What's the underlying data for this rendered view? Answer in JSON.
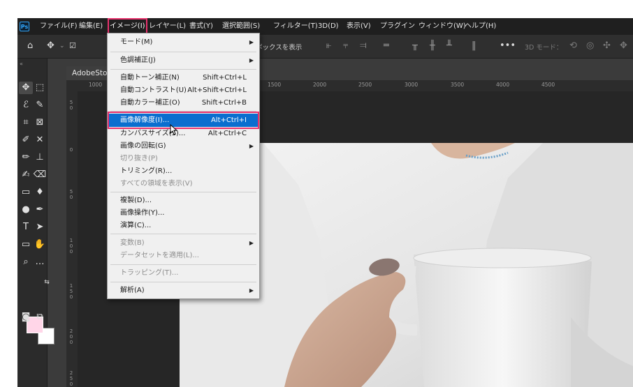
{
  "menubar": {
    "items": [
      {
        "label": "ファイル(F)"
      },
      {
        "label": "編集(E)"
      },
      {
        "label": "イメージ(I)"
      },
      {
        "label": "レイヤー(L)"
      },
      {
        "label": "書式(Y)"
      },
      {
        "label": "選択範囲(S)"
      },
      {
        "label": "フィルター(T)"
      },
      {
        "label": "3D(D)"
      },
      {
        "label": "表示(V)"
      },
      {
        "label": "プラグイン"
      },
      {
        "label": "ウィンドウ(W)"
      },
      {
        "label": "ヘルプ(H)"
      }
    ]
  },
  "options_bar": {
    "visible_text": "ボックスを表示",
    "mode_3d": "3D モード："
  },
  "document": {
    "tab_title": "AdobeSto",
    "ruler_top": [
      "1000",
      "1000",
      "1500",
      "2000",
      "2500",
      "3000",
      "3500",
      "4000",
      "4500"
    ],
    "ruler_left": [
      "5 0",
      "0",
      "5 0",
      "1 0 0",
      "1 5 0",
      "2 0 0",
      "2 5 0"
    ]
  },
  "image_menu": {
    "items": [
      {
        "label": "モード(M)",
        "submenu": true
      },
      {
        "label": "色調補正(J)",
        "submenu": true
      },
      {
        "label": "自動トーン補正(N)",
        "shortcut": "Shift+Ctrl+L"
      },
      {
        "label": "自動コントラスト(U)",
        "shortcut": "Alt+Shift+Ctrl+L"
      },
      {
        "label": "自動カラー補正(O)",
        "shortcut": "Shift+Ctrl+B"
      },
      {
        "label": "画像解像度(I)...",
        "shortcut": "Alt+Ctrl+I"
      },
      {
        "label": "カンバスサイズ(S)...",
        "shortcut": "Alt+Ctrl+C"
      },
      {
        "label": "画像の回転(G)",
        "submenu": true
      },
      {
        "label": "切り抜き(P)"
      },
      {
        "label": "トリミング(R)..."
      },
      {
        "label": "すべての領域を表示(V)"
      },
      {
        "label": "複製(D)..."
      },
      {
        "label": "画像操作(Y)..."
      },
      {
        "label": "演算(C)..."
      },
      {
        "label": "変数(B)",
        "submenu": true
      },
      {
        "label": "データセットを適用(L)..."
      },
      {
        "label": "トラッピング(T)..."
      },
      {
        "label": "解析(A)",
        "submenu": true
      }
    ]
  },
  "colors": {
    "highlight": "#0a6ecf",
    "annotation": "#e8326d",
    "foreground_swatch": "#ffd6e8"
  }
}
